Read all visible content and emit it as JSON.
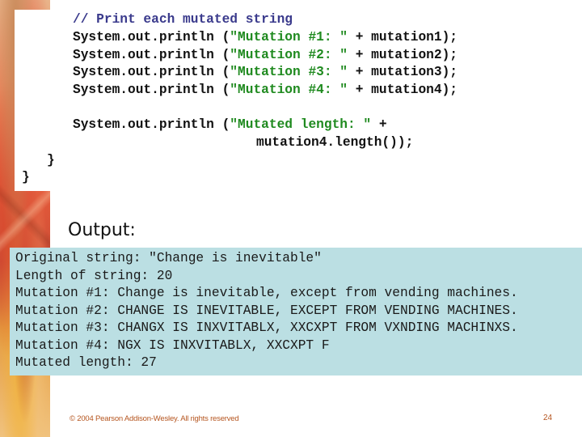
{
  "slide": {
    "code": {
      "comment": "// Print each mutated string",
      "println_lines": [
        {
          "prefix": "System.out.println (",
          "string": "\"Mutation #1: \"",
          "suffix": " + mutation1);"
        },
        {
          "prefix": "System.out.println (",
          "string": "\"Mutation #2: \"",
          "suffix": " + mutation2);"
        },
        {
          "prefix": "System.out.println (",
          "string": "\"Mutation #3: \"",
          "suffix": " + mutation3);"
        },
        {
          "prefix": "System.out.println (",
          "string": "\"Mutation #4: \"",
          "suffix": " + mutation4);"
        }
      ],
      "length_line": {
        "prefix": "System.out.println (",
        "string": "\"Mutated length: \"",
        "suffix": " +"
      },
      "length_continuation": "mutation4.length());",
      "inner_brace": "}",
      "outer_brace": "}"
    },
    "output_label": "Output:",
    "output_lines": [
      "Original string: \"Change is inevitable\"",
      "Length of string: 20",
      "Mutation #1: Change is inevitable, except from vending machines.",
      "Mutation #2: CHANGE IS INEVITABLE, EXCEPT FROM VENDING MACHINES.",
      "Mutation #3: CHANGX IS INXVITABLX, XXCXPT FROM VXNDING MACHINXS.",
      "Mutation #4: NGX IS INXVITABLX, XXCXPT F",
      "Mutated length: 27"
    ],
    "footer": {
      "copyright": "© 2004 Pearson Addison-Wesley. All rights reserved",
      "page_number": "24"
    },
    "colors": {
      "comment": "#3a3a8c",
      "string_literal": "#1f8a1f",
      "output_background": "#bbdfe3",
      "footer_text": "#b5551f"
    }
  }
}
